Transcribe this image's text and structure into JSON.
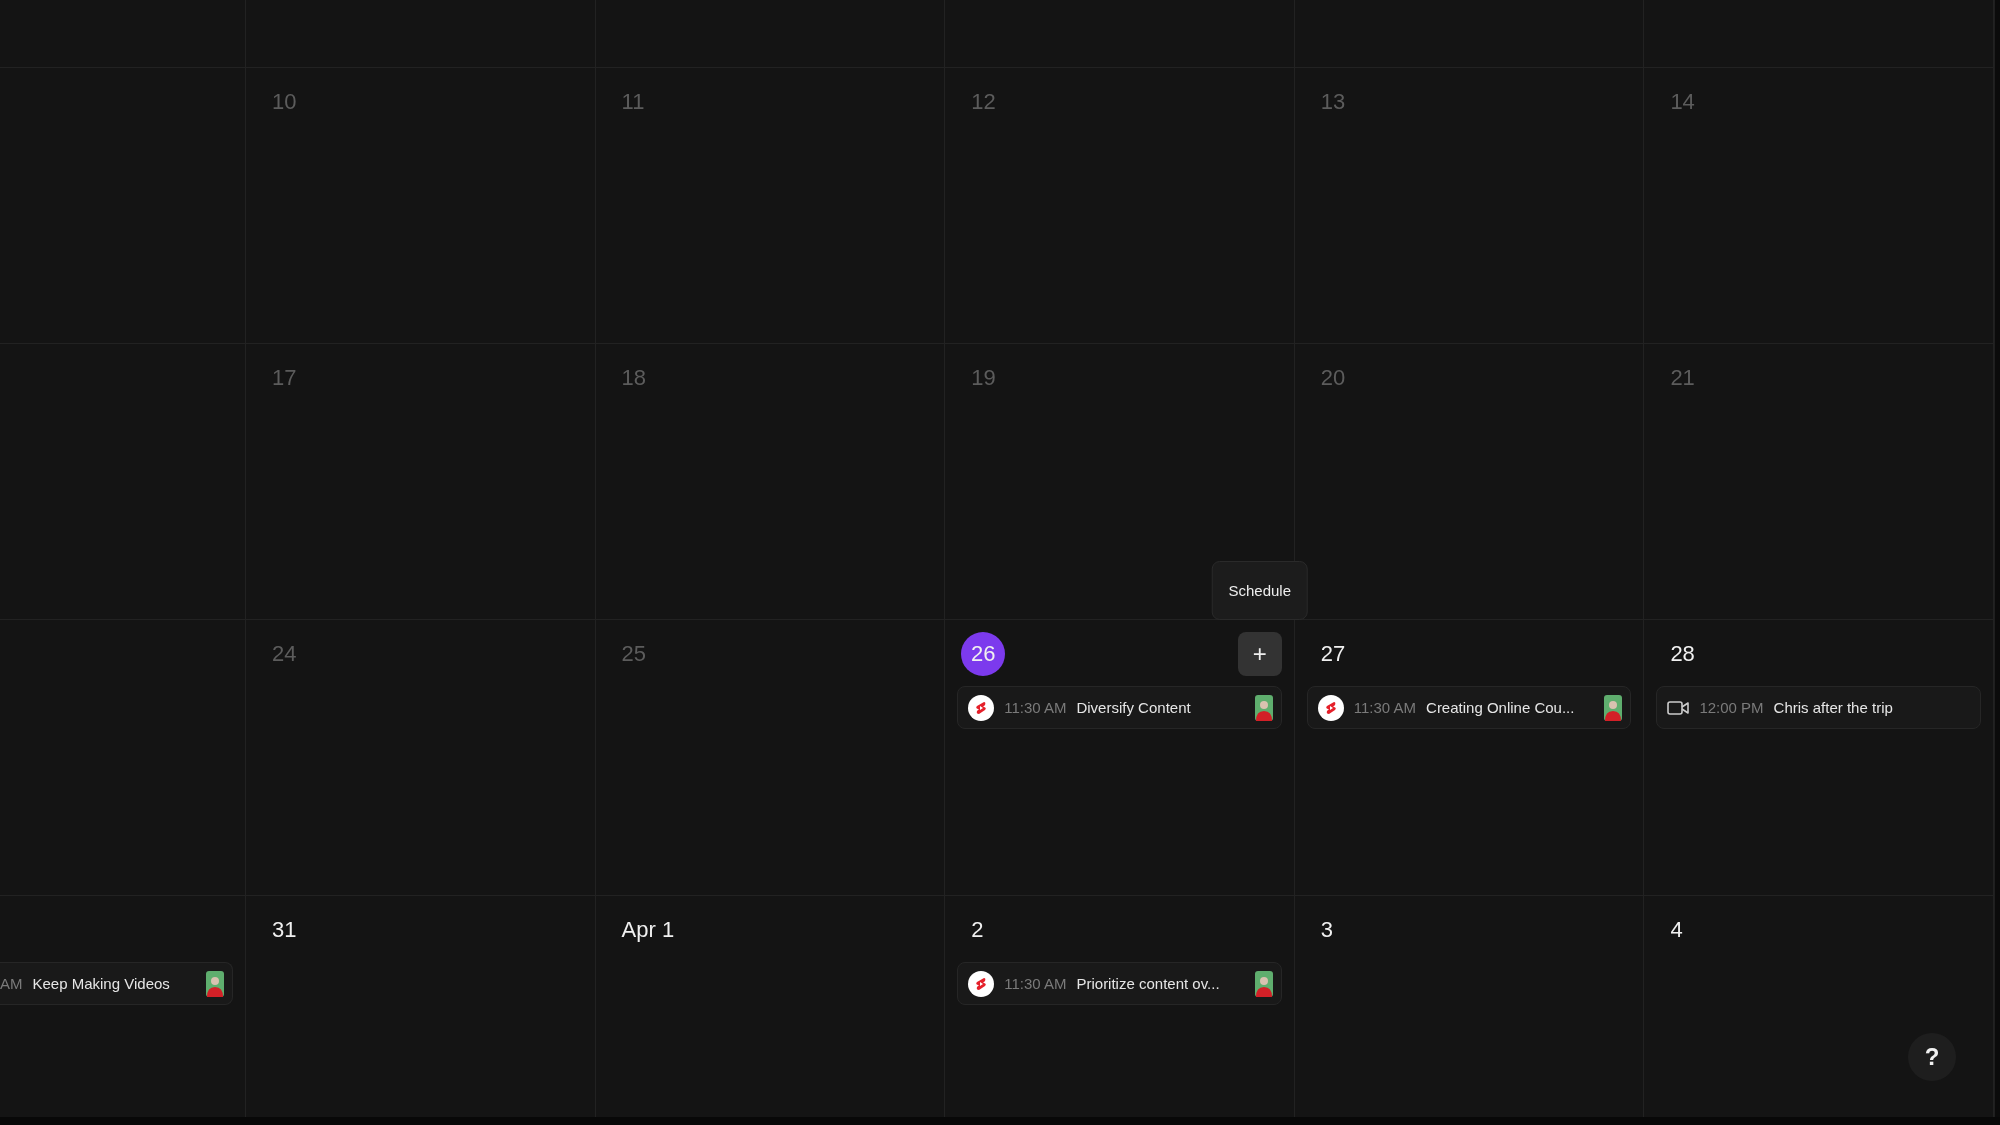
{
  "weeks": [
    {
      "days": [
        {
          "label": "10",
          "muted": true,
          "today": false
        },
        {
          "label": "11",
          "muted": true,
          "today": false
        },
        {
          "label": "12",
          "muted": true,
          "today": false
        },
        {
          "label": "13",
          "muted": true,
          "today": false
        },
        {
          "label": "14",
          "muted": true,
          "today": false
        }
      ]
    },
    {
      "days": [
        {
          "label": "17",
          "muted": true,
          "today": false
        },
        {
          "label": "18",
          "muted": true,
          "today": false
        },
        {
          "label": "19",
          "muted": true,
          "today": false
        },
        {
          "label": "20",
          "muted": true,
          "today": false
        },
        {
          "label": "21",
          "muted": true,
          "today": false
        }
      ]
    },
    {
      "days": [
        {
          "label": "24",
          "muted": true,
          "today": false
        },
        {
          "label": "25",
          "muted": true,
          "today": false
        },
        {
          "label": "26",
          "muted": false,
          "today": true,
          "add_button": {
            "symbol": "+",
            "tooltip": "Schedule"
          },
          "events": [
            {
              "kind": "shorts",
              "time": "11:30 AM",
              "title": "Diversify Content",
              "avatar": true
            }
          ]
        },
        {
          "label": "27",
          "muted": false,
          "today": false,
          "events": [
            {
              "kind": "shorts",
              "time": "11:30 AM",
              "title": "Creating Online Cou...",
              "avatar": true
            }
          ]
        },
        {
          "label": "28",
          "muted": false,
          "today": false,
          "events": [
            {
              "kind": "video",
              "time": "12:00 PM",
              "title": "Chris after the trip",
              "avatar": false
            }
          ]
        }
      ]
    },
    {
      "cut_off_events": [
        {
          "time": "AM",
          "title": "Keep Making Videos",
          "avatar": true
        }
      ],
      "days": [
        {
          "label": "31",
          "muted": false,
          "today": false
        },
        {
          "label": "Apr 1",
          "muted": false,
          "today": false
        },
        {
          "label": "2",
          "muted": false,
          "today": false,
          "events": [
            {
              "kind": "shorts",
              "time": "11:30 AM",
              "title": "Prioritize content ov...",
              "avatar": true
            }
          ]
        },
        {
          "label": "3",
          "muted": false,
          "today": false
        },
        {
          "label": "4",
          "muted": false,
          "today": false
        }
      ]
    }
  ],
  "help_button": {
    "symbol": "?"
  }
}
